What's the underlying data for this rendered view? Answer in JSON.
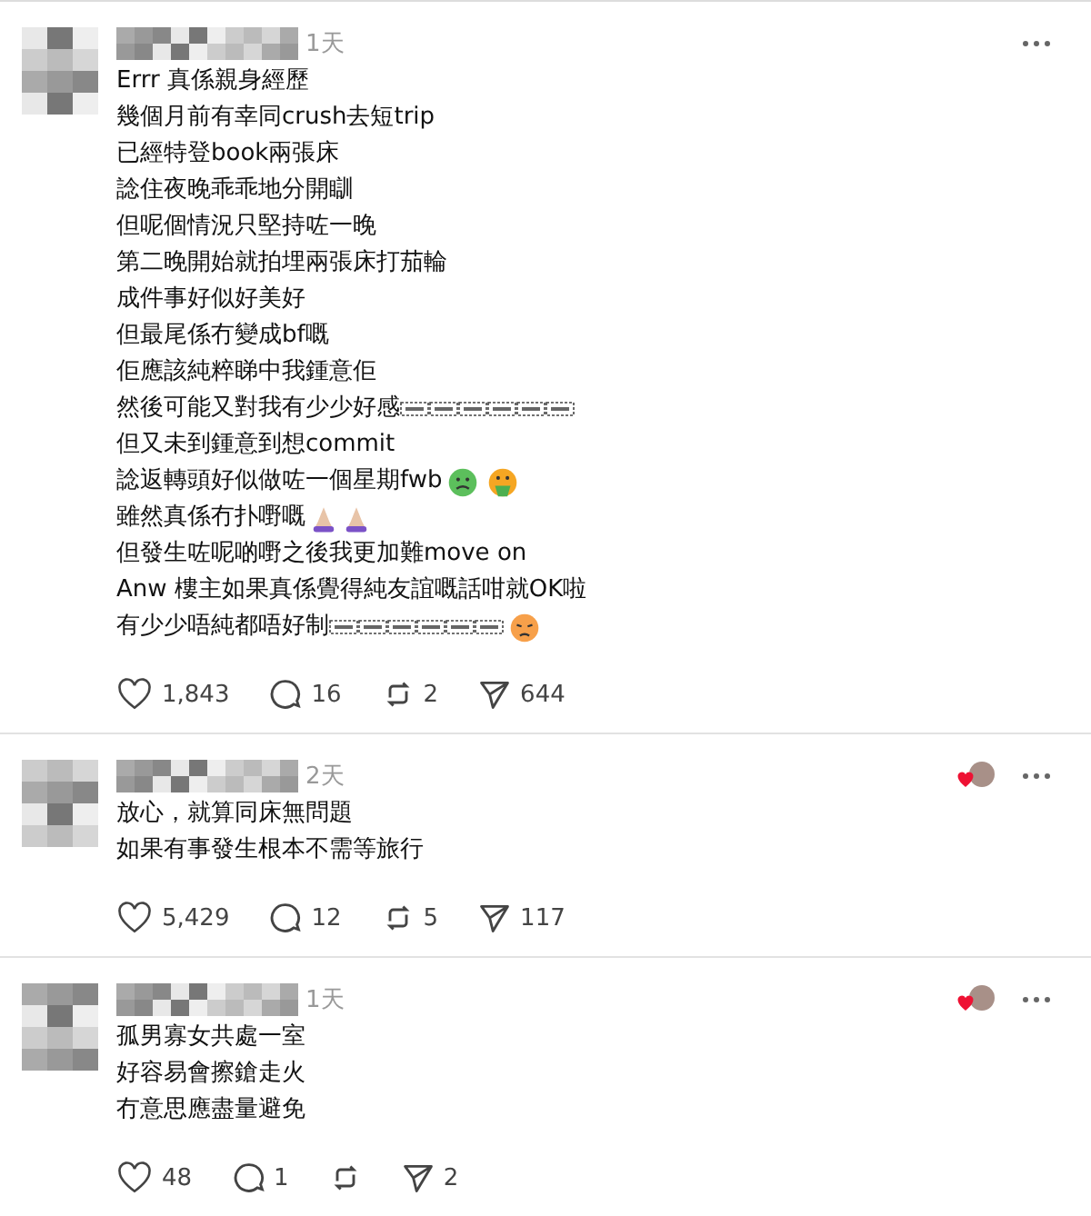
{
  "posts": [
    {
      "time": "1天",
      "author_liked": false,
      "lines": [
        {
          "text": "Errr 真係親身經歷"
        },
        {
          "text": "幾個月前有幸同crush去短trip"
        },
        {
          "text": "已經特登book兩張床"
        },
        {
          "text": "諗住夜晚乖乖地分開瞓"
        },
        {
          "text": "但呢個情況只堅持咗一晚"
        },
        {
          "text": "第二晚開始就拍埋兩張床打茄輪"
        },
        {
          "text": "成件事好似好美好"
        },
        {
          "text": "但最尾係冇變成bf嘅"
        },
        {
          "text": "佢應該純粹睇中我鍾意佢"
        },
        {
          "text": "然後可能又對我有少少好感",
          "trail": [
            {
              "kind": "obj"
            },
            {
              "kind": "obj"
            },
            {
              "kind": "obj"
            },
            {
              "kind": "obj"
            },
            {
              "kind": "obj"
            },
            {
              "kind": "obj"
            }
          ]
        },
        {
          "text": "但又未到鍾意到想commit"
        },
        {
          "text": "諗返轉頭好似做咗一個星期fwb",
          "trail": [
            {
              "kind": "nauseated"
            },
            {
              "kind": "vomiting"
            }
          ]
        },
        {
          "text": "雖然真係冇扑嘢嘅",
          "trail": [
            {
              "kind": "pray"
            },
            {
              "kind": "pray"
            }
          ]
        },
        {
          "text": "但發生咗呢啲嘢之後我更加難move on"
        },
        {
          "text": "Anw 樓主如果真係覺得純友誼嘅話咁就OK啦"
        },
        {
          "text": "有少少唔純都唔好制",
          "trail": [
            {
              "kind": "obj"
            },
            {
              "kind": "obj"
            },
            {
              "kind": "obj"
            },
            {
              "kind": "obj"
            },
            {
              "kind": "obj"
            },
            {
              "kind": "obj"
            },
            {
              "kind": "sad"
            }
          ]
        }
      ],
      "likes": "1,843",
      "replies": "16",
      "reposts": "2",
      "shares": "644"
    },
    {
      "time": "2天",
      "author_liked": true,
      "lines": [
        {
          "text": "放心，就算同床無問題"
        },
        {
          "text": "如果有事發生根本不需等旅行"
        }
      ],
      "likes": "5,429",
      "replies": "12",
      "reposts": "5",
      "shares": "117"
    },
    {
      "time": "1天",
      "author_liked": true,
      "lines": [
        {
          "text": "孤男寡女共處一室"
        },
        {
          "text": "好容易會擦鎗走火"
        },
        {
          "text": "冇意思應盡量避免"
        }
      ],
      "likes": "48",
      "replies": "1",
      "shares": "2"
    }
  ]
}
